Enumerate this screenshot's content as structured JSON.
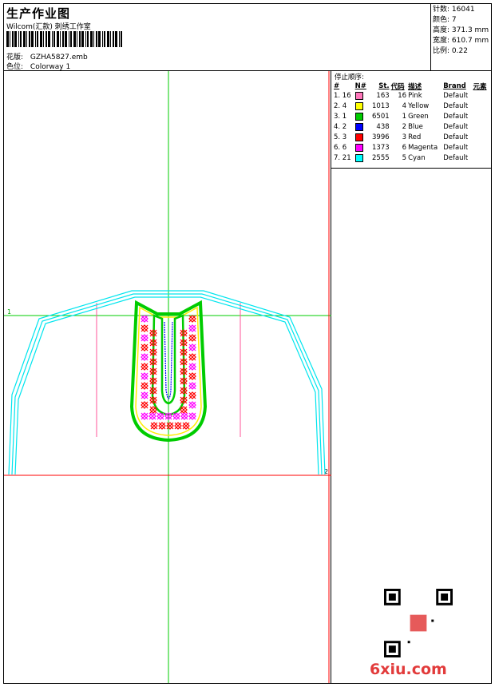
{
  "header": {
    "title": "生产作业图",
    "subtitle": "Wilcom(汇款) 刺绣工作室",
    "pattern_label": "花版:",
    "pattern_value": "GZHA5827.emb",
    "colorway_label": "色位:",
    "colorway_value": "Colorway 1"
  },
  "stats": [
    {
      "label": "针数:",
      "value": "16041"
    },
    {
      "label": "颜色:",
      "value": "7"
    },
    {
      "label": "高度:",
      "value": "371.3 mm"
    },
    {
      "label": "宽度:",
      "value": "610.7 mm"
    },
    {
      "label": "比例:",
      "value": "0.22"
    }
  ],
  "sequence": {
    "title": "停止顺序:",
    "headers": [
      "#",
      "N#",
      "St.",
      "代码",
      "描述",
      "Brand",
      "元素"
    ],
    "rows": [
      {
        "order": "1. 16",
        "color": "#ff77bb",
        "stitches": "163",
        "code": "16",
        "desc": "Pink",
        "brand": "Default"
      },
      {
        "order": "2. 4",
        "color": "#ffff00",
        "stitches": "1013",
        "code": "4",
        "desc": "Yellow",
        "brand": "Default"
      },
      {
        "order": "3. 1",
        "color": "#00cc00",
        "stitches": "6501",
        "code": "1",
        "desc": "Green",
        "brand": "Default"
      },
      {
        "order": "4. 2",
        "color": "#0000ff",
        "stitches": "438",
        "code": "2",
        "desc": "Blue",
        "brand": "Default"
      },
      {
        "order": "5. 3",
        "color": "#ff0000",
        "stitches": "3996",
        "code": "3",
        "desc": "Red",
        "brand": "Default"
      },
      {
        "order": "6. 6",
        "color": "#ff00ff",
        "stitches": "1373",
        "code": "6",
        "desc": "Magenta",
        "brand": "Default"
      },
      {
        "order": "7. 21",
        "color": "#00ffff",
        "stitches": "2555",
        "code": "5",
        "desc": "Cyan",
        "brand": "Default"
      }
    ]
  },
  "design": {
    "marker_1": "1",
    "marker_2": "2"
  },
  "watermark": {
    "text": "6xiu.com"
  },
  "colors": {
    "guide_green": "#00cc00",
    "guide_red": "#ff0000",
    "outline_cyan": "#00e5ee",
    "pink_lines": "#ff5599"
  }
}
